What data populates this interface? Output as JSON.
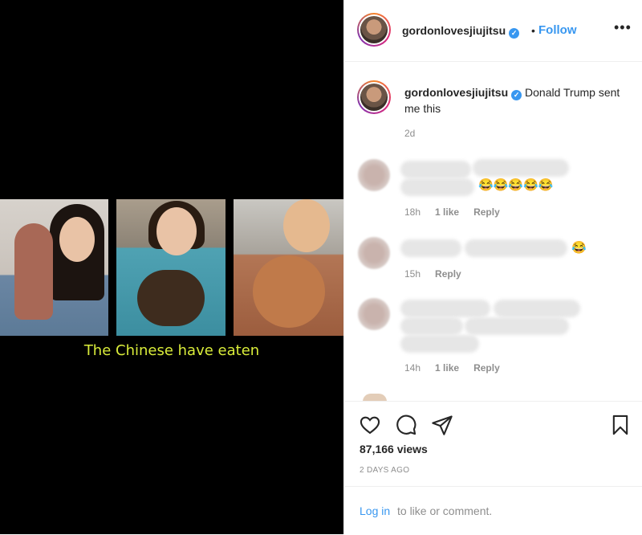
{
  "media": {
    "caption": "The Chinese have eaten"
  },
  "post": {
    "username": "gordonlovesjiujitsu",
    "verified_glyph": "✓",
    "separator": "•",
    "follow_label": "Follow",
    "more_label": "•••",
    "caption_text": "Donald Trump sent me this",
    "caption_time": "2d"
  },
  "comments": [
    {
      "time": "18h",
      "likes": "1 like",
      "reply": "Reply",
      "emoji": "😂😂😂😂😂"
    },
    {
      "time": "15h",
      "reply": "Reply",
      "emoji": "😂"
    },
    {
      "time": "14h",
      "likes": "1 like",
      "reply": "Reply"
    }
  ],
  "stats": {
    "views": "87,166 views",
    "posted": "2 DAYS AGO"
  },
  "login": {
    "link": "Log in",
    "rest": "to like or comment."
  },
  "colors": {
    "accent": "#3897f0",
    "text": "#262626",
    "muted": "#8e8e8e",
    "caption_yellow": "#d9ec3a"
  },
  "icons": [
    "heart-icon",
    "comment-icon",
    "share-icon",
    "bookmark-icon"
  ]
}
